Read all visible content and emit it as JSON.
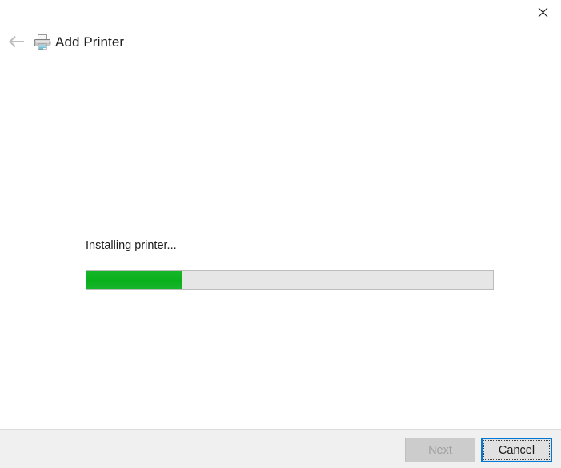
{
  "window": {
    "title": "Add Printer",
    "close_icon": "close-icon",
    "back_icon": "back-arrow-icon",
    "printer_icon": "printer-icon"
  },
  "content": {
    "status_text": "Installing printer...",
    "progress": {
      "percent": 23.5,
      "fill_color": "#0cb11e",
      "track_color": "#e6e6e6",
      "border_color": "#bcbcbc"
    }
  },
  "footer": {
    "next_label": "Next",
    "next_enabled": false,
    "cancel_label": "Cancel",
    "cancel_focused": true,
    "focus_color": "#0078d7"
  }
}
